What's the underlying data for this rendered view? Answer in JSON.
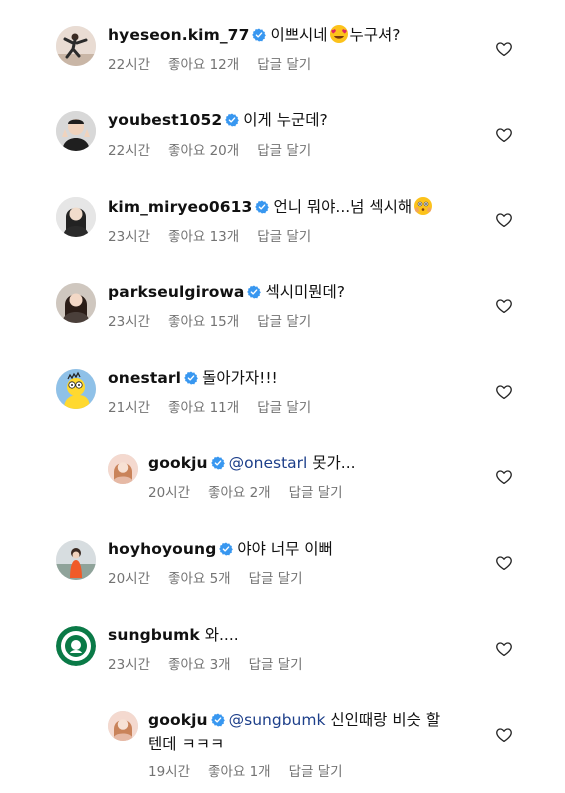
{
  "comments": [
    {
      "username": "hyeseon.kim_77",
      "text_before": "이쁘시네",
      "emoji": "heart-eyes-emoji",
      "text_after": "누구셔?",
      "time": "22시간",
      "likes": "좋아요 12개",
      "reply": "답글 달기"
    },
    {
      "username": "youbest1052",
      "text": "이게 누군데?",
      "time": "22시간",
      "likes": "좋아요 20개",
      "reply": "답글 달기"
    },
    {
      "username": "kim_miryeo0613",
      "text": "언니 뭐야...넘 섹시해",
      "emoji": "flushed-face-emoji",
      "time": "23시간",
      "likes": "좋아요 13개",
      "reply": "답글 달기"
    },
    {
      "username": "parkseulgirowa",
      "text": "섹시미뭔데?",
      "time": "23시간",
      "likes": "좋아요 15개",
      "reply": "답글 달기"
    },
    {
      "username": "onestarl",
      "text": "돌아가자!!!",
      "time": "21시간",
      "likes": "좋아요 11개",
      "reply": "답글 달기"
    },
    {
      "username": "gookju",
      "mention": "@onestarl",
      "text": "못가...",
      "time": "20시간",
      "likes": "좋아요 2개",
      "reply": "답글 달기"
    },
    {
      "username": "hoyhoyoung",
      "text": "야야 너무 이뻐",
      "time": "20시간",
      "likes": "좋아요 5개",
      "reply": "답글 달기"
    },
    {
      "username": "sungbumk",
      "text": "와....",
      "time": "23시간",
      "likes": "좋아요 3개",
      "reply": "답글 달기"
    },
    {
      "username": "gookju",
      "mention": "@sungbumk",
      "text": "신인때랑 비슷 할",
      "text_cont": "텐데 ㅋㅋㅋ",
      "time": "19시간",
      "likes": "좋아요 1개",
      "reply": "답글 달기"
    }
  ],
  "icons": {
    "verified": "verified-badge-icon",
    "like": "heart-outline-icon"
  },
  "colors": {
    "verified_blue": "#3897f0",
    "meta_gray": "#737373",
    "mention_blue": "#1d3f8a"
  }
}
